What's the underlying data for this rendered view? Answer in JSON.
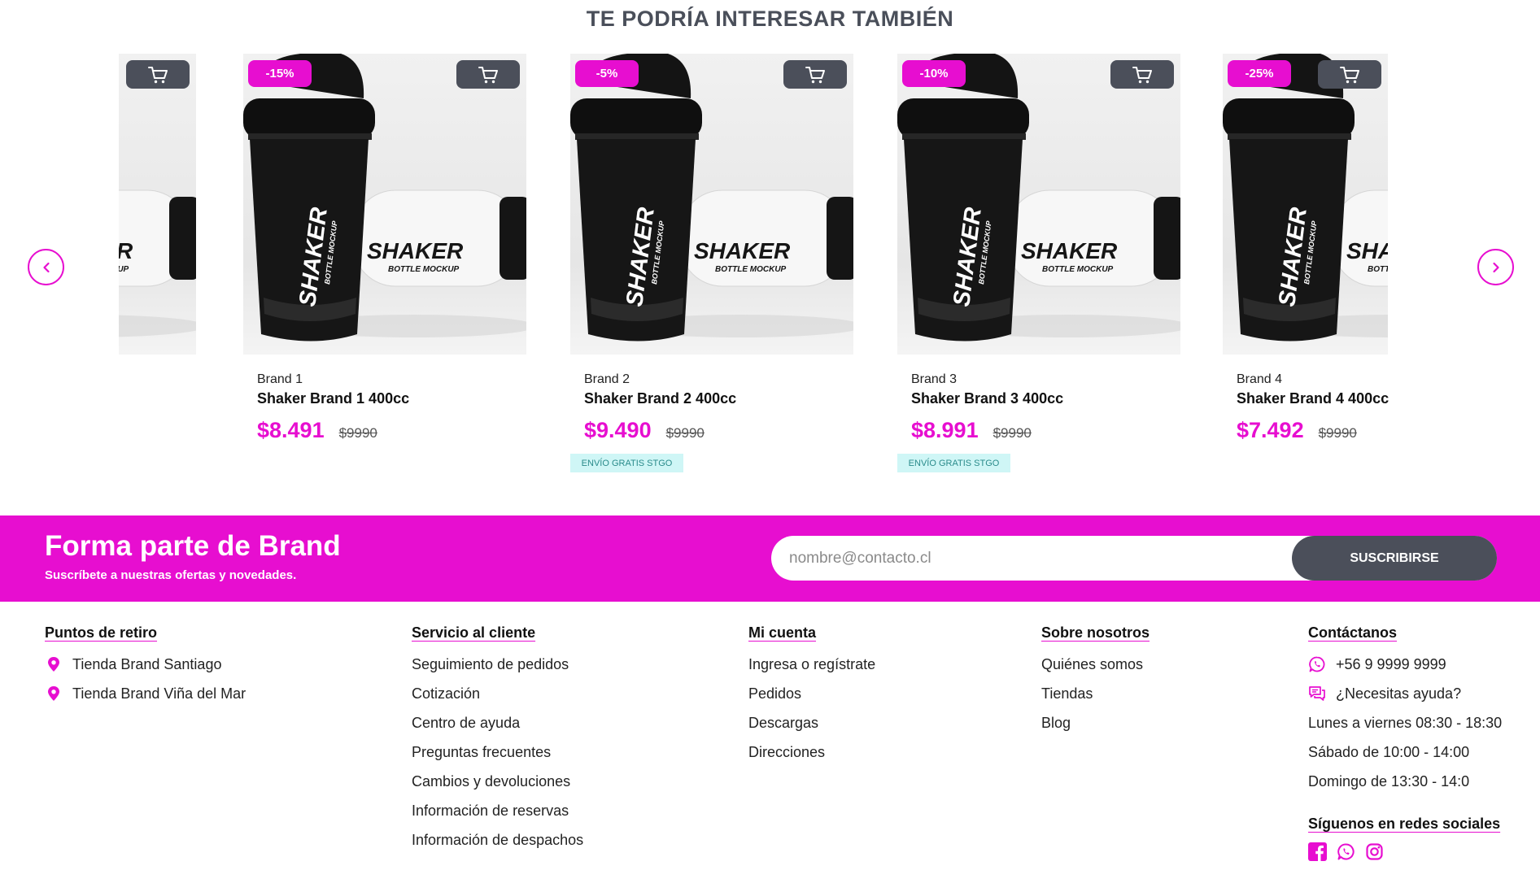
{
  "section_title": "TE PODRÍA INTERESAR TAMBIÉN",
  "products": [
    {
      "brand": "",
      "name": "",
      "price": "",
      "old_price": "",
      "discount": "",
      "free_shipping": ""
    },
    {
      "brand": "Brand 1",
      "name": "Shaker Brand 1 400cc",
      "price": "$8.491",
      "old_price": "$9990",
      "discount": "-15%",
      "free_shipping": ""
    },
    {
      "brand": "Brand 2",
      "name": "Shaker Brand 2 400cc",
      "price": "$9.490",
      "old_price": "$9990",
      "discount": "-5%",
      "free_shipping": "ENVÍO GRATIS STGO"
    },
    {
      "brand": "Brand 3",
      "name": "Shaker Brand 3 400cc",
      "price": "$8.991",
      "old_price": "$9990",
      "discount": "-10%",
      "free_shipping": "ENVÍO GRATIS STGO"
    },
    {
      "brand": "Brand 4",
      "name": "Shaker Brand 4 400cc",
      "price": "$7.492",
      "old_price": "$9990",
      "discount": "-25%",
      "free_shipping": ""
    }
  ],
  "product_image": {
    "bottle_text": "SHAKER",
    "bottle_subtext": "BOTTLE MOCKUP"
  },
  "newsletter": {
    "title": "Forma parte de Brand",
    "subtitle": "Suscríbete a nuestras ofertas y novedades.",
    "placeholder": "nombre@contacto.cl",
    "button": "SUSCRIBIRSE"
  },
  "footer": {
    "pickup": {
      "title": "Puntos de retiro",
      "items": [
        "Tienda Brand Santiago",
        "Tienda Brand Viña del Mar"
      ]
    },
    "service": {
      "title": "Servicio al cliente",
      "items": [
        "Seguimiento de pedidos",
        "Cotización",
        "Centro de ayuda",
        "Preguntas frecuentes",
        "Cambios y devoluciones",
        "Información de reservas",
        "Información de despachos"
      ]
    },
    "account": {
      "title": "Mi cuenta",
      "items": [
        "Ingresa o regístrate",
        "Pedidos",
        "Descargas",
        "Direcciones"
      ]
    },
    "about": {
      "title": "Sobre nosotros",
      "items": [
        "Quiénes somos",
        "Tiendas",
        "Blog"
      ]
    },
    "contact": {
      "title": "Contáctanos",
      "phone": "+56 9 9999 9999",
      "help": "¿Necesitas ayuda?",
      "hours": [
        "Lunes a viernes 08:30 - 18:30",
        "Sábado de 10:00 - 14:00",
        "Domingo de 13:30 - 14:0"
      ],
      "social_title": "Síguenos en redes sociales",
      "social_icons": [
        "facebook-icon",
        "whatsapp-icon",
        "instagram-icon"
      ]
    }
  },
  "colors": {
    "accent": "#e70ed0",
    "dark": "#4b4f5a",
    "tag_bg": "#cff6f6"
  }
}
